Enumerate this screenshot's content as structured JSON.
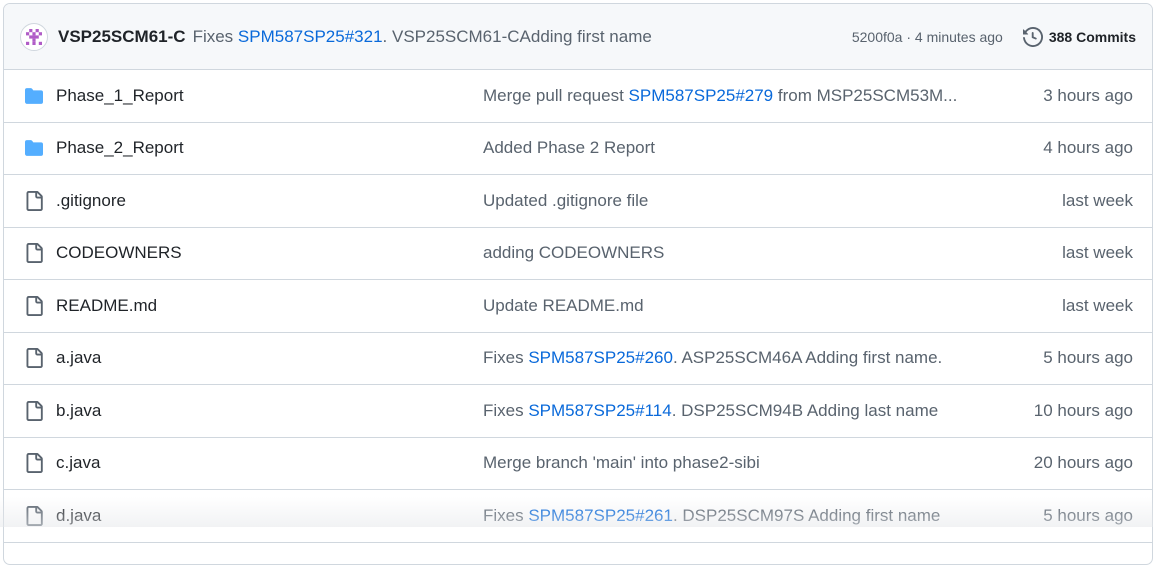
{
  "header": {
    "author": "VSP25SCM61-C",
    "message_prefix": "Fixes",
    "message_link": "SPM587SP25#321",
    "message_suffix": ". VSP25SCM61-CAdding first name",
    "sha_time": "5200f0a · 4 minutes ago",
    "commits_label": "388 Commits"
  },
  "colors": {
    "folder": "#54aeff",
    "link": "#0969da",
    "muted": "#59636e",
    "border": "#d0d7de",
    "header_bg": "#f6f8fa"
  },
  "files": [
    {
      "type": "folder",
      "icon": "folder-icon",
      "name": "Phase_1_Report",
      "msg_prefix": "Merge pull request ",
      "msg_link": "SPM587SP25#279",
      "msg_suffix": " from MSP25SCM53M...",
      "time": "3 hours ago"
    },
    {
      "type": "folder",
      "icon": "folder-icon",
      "name": "Phase_2_Report",
      "msg_prefix": "Added Phase 2 Report",
      "msg_link": "",
      "msg_suffix": "",
      "time": "4 hours ago"
    },
    {
      "type": "file",
      "icon": "file-icon",
      "name": ".gitignore",
      "msg_prefix": "Updated .gitignore file",
      "msg_link": "",
      "msg_suffix": "",
      "time": "last week"
    },
    {
      "type": "file",
      "icon": "file-icon",
      "name": "CODEOWNERS",
      "msg_prefix": "adding CODEOWNERS",
      "msg_link": "",
      "msg_suffix": "",
      "time": "last week"
    },
    {
      "type": "file",
      "icon": "file-icon",
      "name": "README.md",
      "msg_prefix": "Update README.md",
      "msg_link": "",
      "msg_suffix": "",
      "time": "last week"
    },
    {
      "type": "file",
      "icon": "file-icon",
      "name": "a.java",
      "msg_prefix": "Fixes ",
      "msg_link": "SPM587SP25#260",
      "msg_suffix": ". ASP25SCM46A Adding first name.",
      "time": "5 hours ago"
    },
    {
      "type": "file",
      "icon": "file-icon",
      "name": "b.java",
      "msg_prefix": "Fixes ",
      "msg_link": "SPM587SP25#114",
      "msg_suffix": ". DSP25SCM94B Adding last name",
      "time": "10 hours ago"
    },
    {
      "type": "file",
      "icon": "file-icon",
      "name": "c.java",
      "msg_prefix": "Merge branch 'main' into phase2-sibi",
      "msg_link": "",
      "msg_suffix": "",
      "time": "20 hours ago"
    },
    {
      "type": "file",
      "icon": "file-icon",
      "name": "d.java",
      "msg_prefix": "Fixes ",
      "msg_link": "SPM587SP25#261",
      "msg_suffix": ". DSP25SCM97S Adding first name",
      "time": "5 hours ago"
    }
  ]
}
